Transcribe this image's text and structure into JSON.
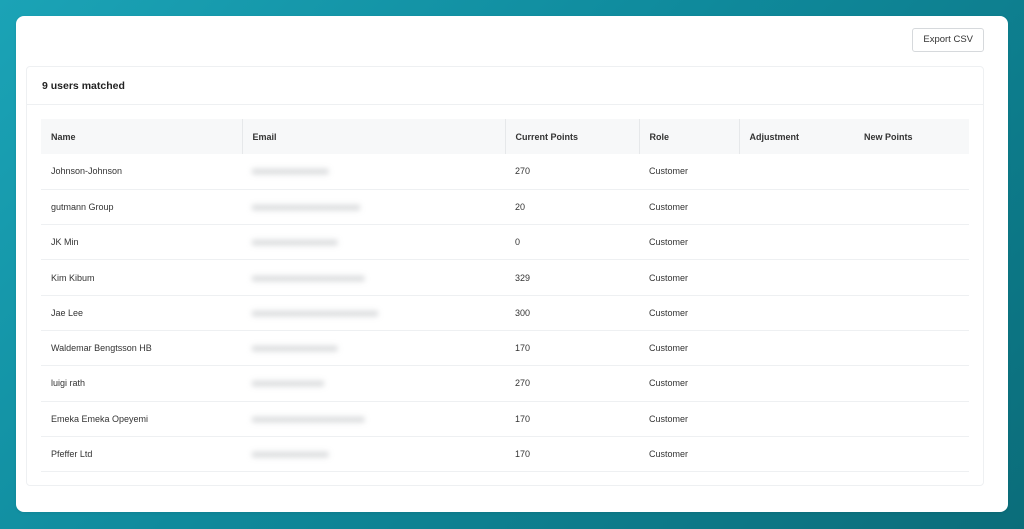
{
  "toolbar": {
    "export_label": "Export CSV"
  },
  "card": {
    "title": "9 users matched"
  },
  "table": {
    "columns": [
      "Name",
      "Email",
      "Current Points",
      "Role",
      "Adjustment",
      "New Points"
    ],
    "rows": [
      {
        "name": "Johnson-Johnson",
        "email": "",
        "points": "270",
        "role": "Customer",
        "adjustment": "",
        "new_points": ""
      },
      {
        "name": "gutmann Group",
        "email": "",
        "points": "20",
        "role": "Customer",
        "adjustment": "",
        "new_points": ""
      },
      {
        "name": "JK Min",
        "email": "",
        "points": "0",
        "role": "Customer",
        "adjustment": "",
        "new_points": ""
      },
      {
        "name": "Kim Kibum",
        "email": "",
        "points": "329",
        "role": "Customer",
        "adjustment": "",
        "new_points": ""
      },
      {
        "name": "Jae Lee",
        "email": "",
        "points": "300",
        "role": "Customer",
        "adjustment": "",
        "new_points": ""
      },
      {
        "name": "Waldemar Bengtsson HB",
        "email": "",
        "points": "170",
        "role": "Customer",
        "adjustment": "",
        "new_points": ""
      },
      {
        "name": "luigi rath",
        "email": "",
        "points": "270",
        "role": "Customer",
        "adjustment": "",
        "new_points": ""
      },
      {
        "name": "Emeka Emeka Opeyemi",
        "email": "",
        "points": "170",
        "role": "Customer",
        "adjustment": "",
        "new_points": ""
      },
      {
        "name": "Pfeffer Ltd",
        "email": "",
        "points": "170",
        "role": "Customer",
        "adjustment": "",
        "new_points": ""
      }
    ]
  },
  "colors": {
    "background_start": "#1ba3b6",
    "background_end": "#0b6d7a",
    "header_row": "#f7f8f9"
  }
}
